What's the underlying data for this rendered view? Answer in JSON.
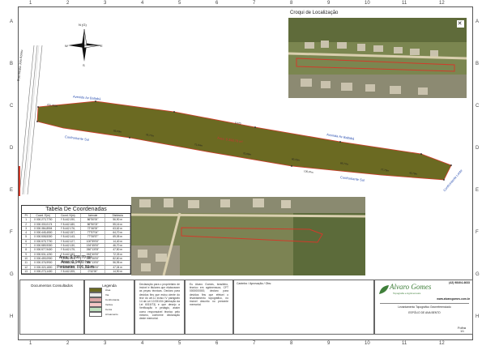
{
  "colors": {
    "lot_fill": "#6b6a22",
    "lot_stroke": "#d23a2a",
    "label_blue": "#2a4fb0",
    "brand_green": "#3f7f3a"
  },
  "grid": {
    "columns": [
      "1",
      "2",
      "3",
      "4",
      "5",
      "6",
      "7",
      "8",
      "9",
      "10",
      "11",
      "12"
    ],
    "rows": [
      "A",
      "B",
      "C",
      "D",
      "E",
      "F",
      "G",
      "H"
    ]
  },
  "north_arrow": {
    "label": "N (G)",
    "w": "W",
    "e": "E",
    "s": "S",
    "icon": "compass-rose-icon"
  },
  "plan": {
    "road_left": "Rua Beata Jolo Abreu",
    "street_top": "Avenida Av Baltabá",
    "street_top_right": "Avenida Av Baltabá",
    "confrontante_left": "Confrontante Sul",
    "confrontante_bottom": "Confrontante Sul",
    "confrontante_right": "Confrontante Leste",
    "area_label": "Área: 9.398,70 m²",
    "segment_labels": [
      "201,700m",
      "8.270",
      "83,60m",
      "76,77m",
      "71,04m",
      "70,88m",
      "60,25m",
      "68,77m",
      "77,79m",
      "43,70m",
      "100,87m"
    ]
  },
  "croqui": {
    "title": "Croqui de Localização",
    "close_icon": "close-icon"
  },
  "coord_table": {
    "title": "Tabela De Coordenadas",
    "headers": [
      "Pt",
      "Coord. E(m)",
      "Coord. N(m)",
      "Azimute",
      "Distância"
    ],
    "rows": [
      [
        "1",
        "X 000.273,7700",
        "Y 8.442.190,",
        "86°50'00\"",
        "56,90 m"
      ],
      [
        "2",
        "X 000.330,0174",
        "Y 8.442.180,",
        "86°50'03\"",
        "55,16 m"
      ],
      [
        "3",
        "X 000.384,8504",
        "Y 8.442.176,",
        "72°46'00\"",
        "63,62 m"
      ],
      [
        "4",
        "X 000.445,4500",
        "Y 8.442.157,",
        "77°57'04\"",
        "64,70 m"
      ],
      [
        "5",
        "X 000.508,5300",
        "Y 8.442.143,",
        "77°06'57\"",
        "69,05 m"
      ],
      [
        "6",
        "X 000.575,7700",
        "Y 8.442.127,",
        "100°59'00\"",
        "14,40 m"
      ],
      [
        "7",
        "X 000.589,9300",
        "Y 8.442.130,",
        "194°45'00\"",
        "46,70 m"
      ],
      [
        "8",
        "X 000.577,9400",
        "Y 8.442.175,",
        "260°13'05\"",
        "47,50 m"
      ],
      [
        "9",
        "X 000.531,1200",
        "Y 8.442.183,",
        "263°40'00\"",
        "72,33 m"
      ],
      [
        "10",
        "X 000.459,0900",
        "Y 8.442.191,",
        "264°06'00\"",
        "82,60 m"
      ],
      [
        "11",
        "X 000.376,9900",
        "Y 8.442.200,",
        "265°13'00\"",
        "56,95 m"
      ],
      [
        "12",
        "X 000.320,1800",
        "Y 8.442.205,",
        "269°39'00\"",
        "47,04 m"
      ],
      [
        "13",
        "X 000.273,1400",
        "Y 8.442.205,",
        "0°42'00\"",
        "14,90 m"
      ]
    ],
    "area": "Área: 9.398,70 m²",
    "area_ha": "Área: 0,9400 ha",
    "perimeter": "Perímetro: 806,80 m"
  },
  "bottom": {
    "docs_title": "Documentos Consultados",
    "legend_title": "Legenda",
    "legend_items": [
      {
        "label": "Área",
        "color": "#6b6a22"
      },
      {
        "label": "Via",
        "color": "#e8e8e8"
      },
      {
        "label": "Confrontante",
        "color": "#d9a3a3"
      },
      {
        "label": "Vértice",
        "color": "#f3c7c7"
      },
      {
        "label": "Cerca",
        "color": "#bfe0bf"
      },
      {
        "label": "Arruamento",
        "color": "#ffffff"
      }
    ],
    "declaration_text": "Declaração para o proprietário de imóvel e titulares que elaboraram as peças técnicas. Declaro para devidos fins que estou ciente do teor do art.11 inciso IV parágrafo 14 da Lei 10.931/04 (alteração da Lei 6015/73) e que desejo a Verificação e pedágio, assim como responsável técnico pelo mesmo, conforme declaração deste memorial.",
    "declaration_text2": "Eu Alvaro Gomes, brasileiro, técnico em agrimensura, CFT 0000000000, declaro para devidos fins que efetuei o levantamento topográfico, no imóvel descrito no presente memorial.",
    "carimbo_title": "Carimbo / Aprovação / Obs:",
    "brand_name": "Alvaro Gomes",
    "brand_sub": "Topografia e Agrimensura",
    "phone": "(42) 98404-4633",
    "site": "www.alvarogomes.com.br",
    "project_title": "Levantamento Topográfico Georreferenciado",
    "owner_label": "ESPÓLIO DE ANA BENTO",
    "sheet_label": "Folha",
    "sheet_value": "1/1"
  }
}
